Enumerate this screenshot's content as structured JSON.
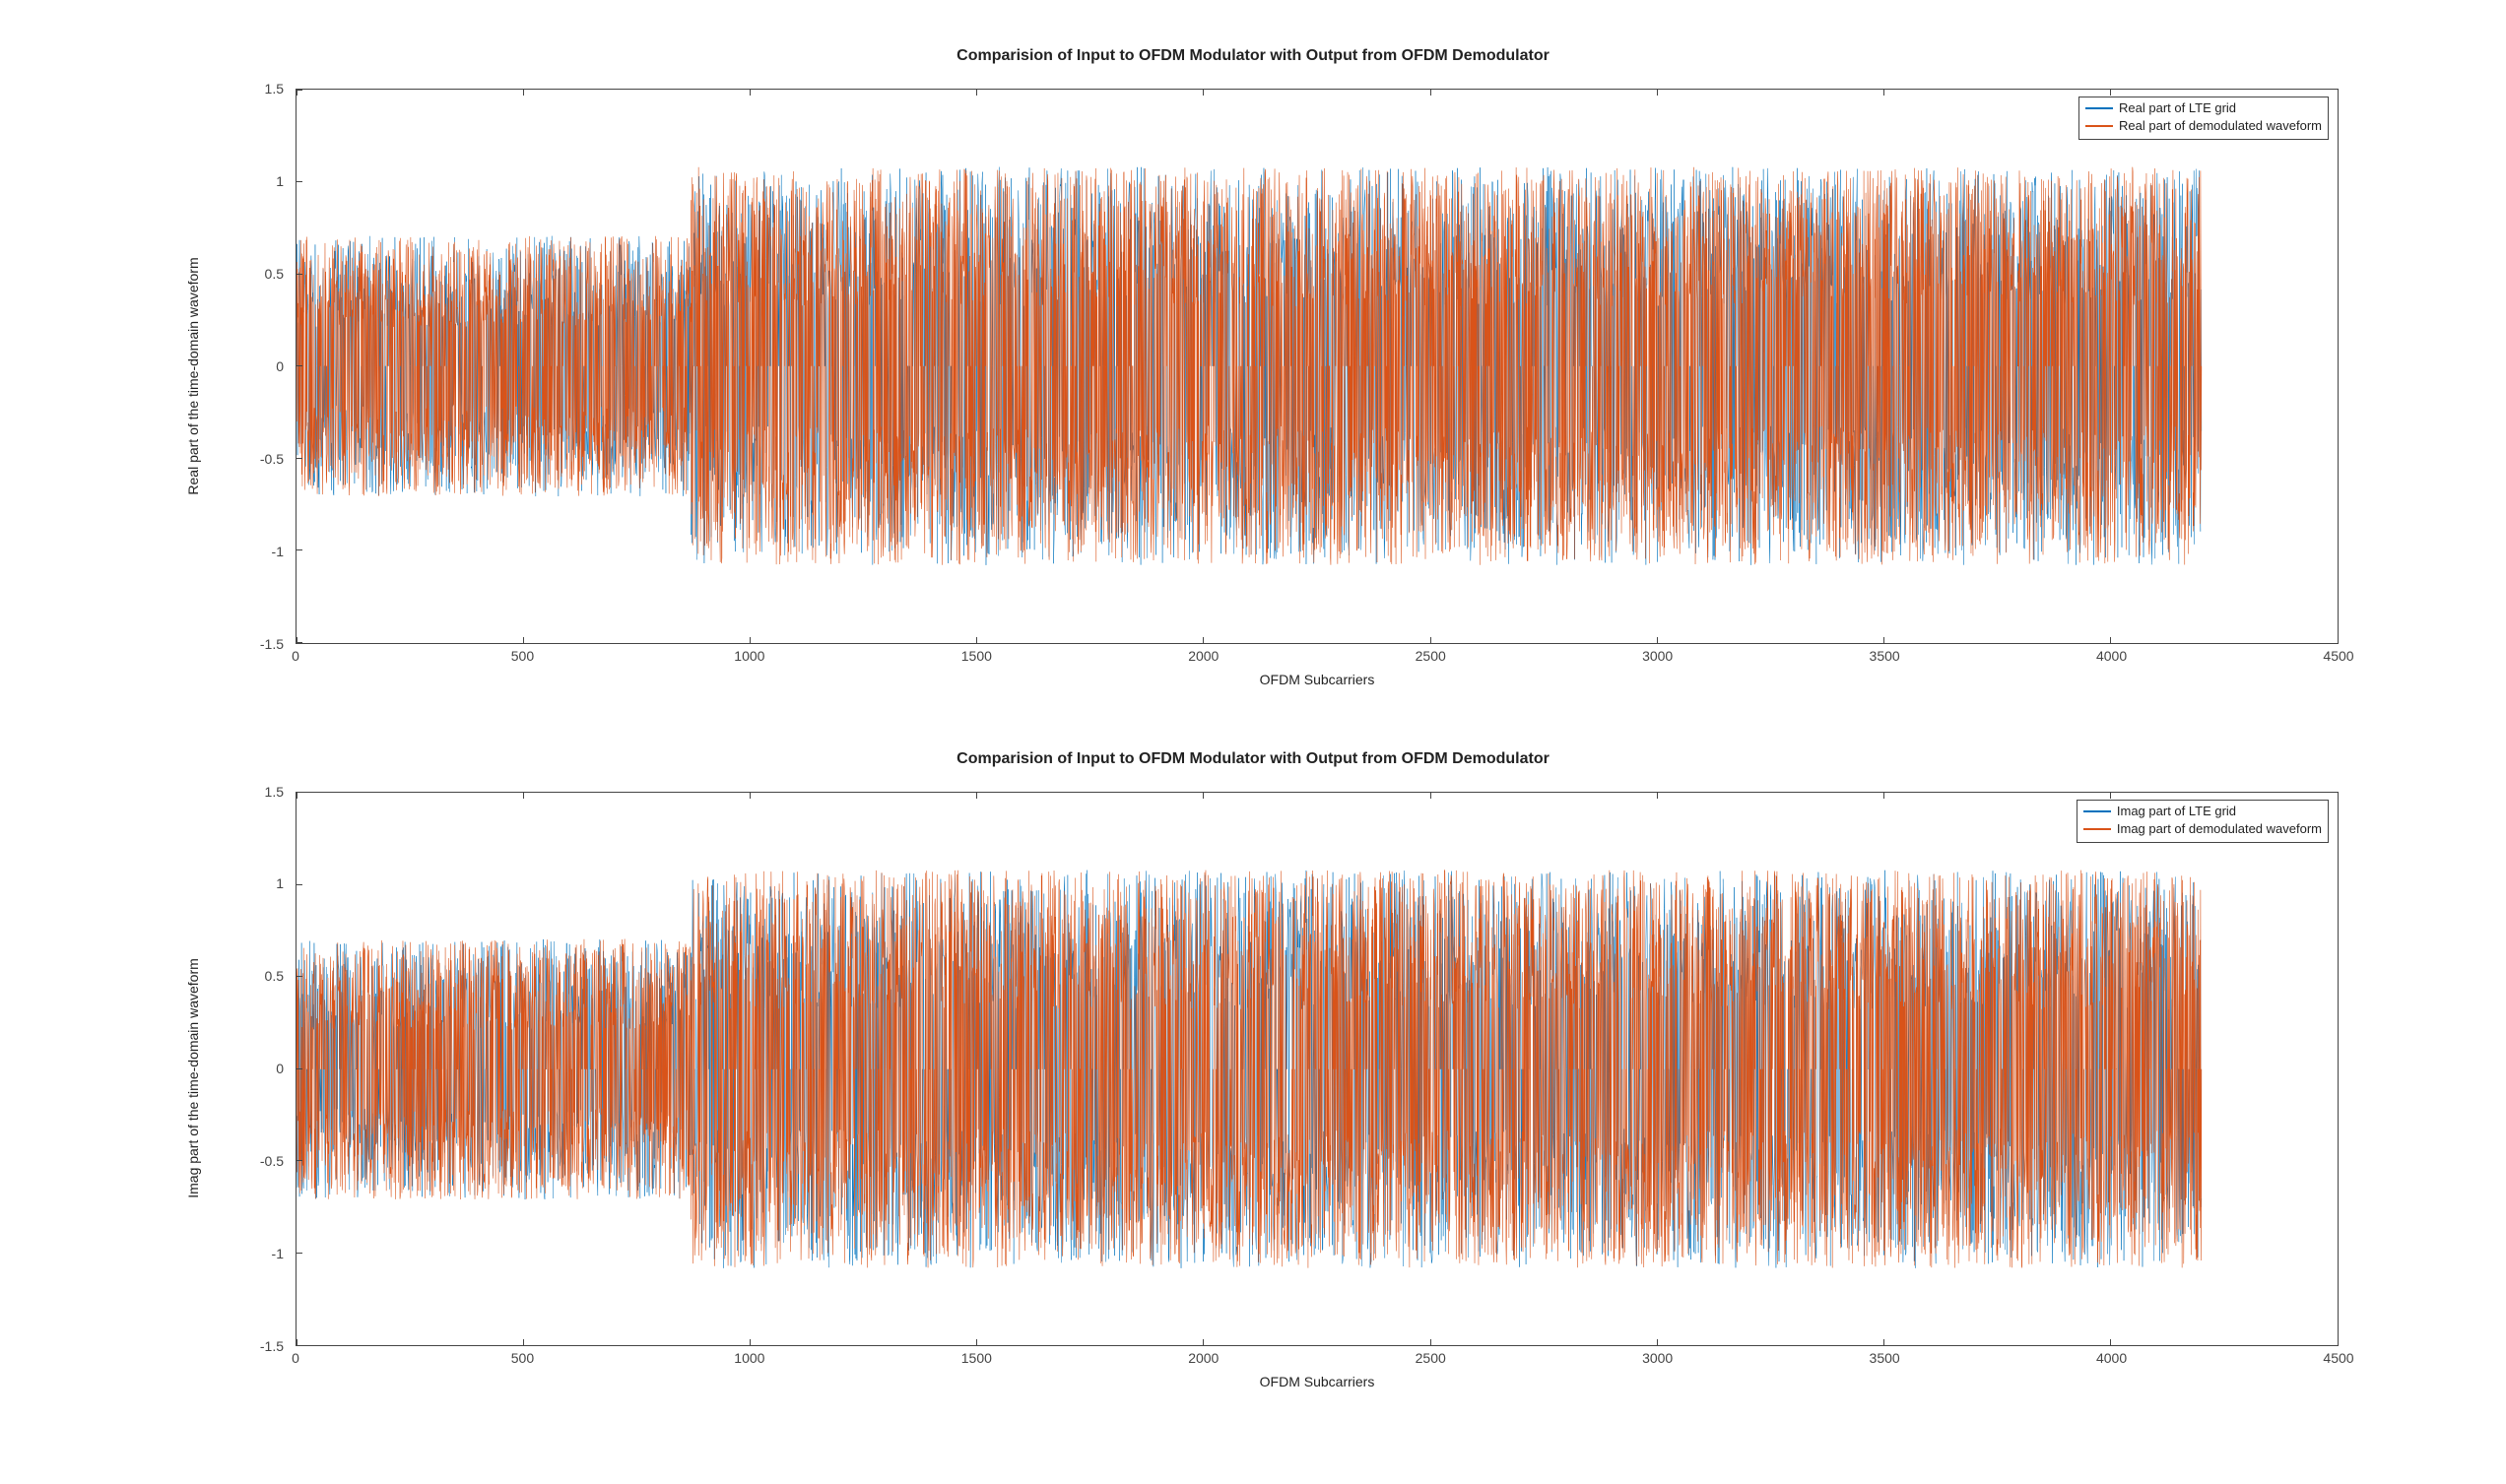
{
  "colors": {
    "series_blue": "#0072BD",
    "series_orange": "#D95319"
  },
  "chart_data": [
    {
      "type": "line",
      "title": "Comparision of Input to OFDM Modulator with Output from OFDM Demodulator",
      "xlabel": "OFDM Subcarriers",
      "ylabel": "Real part of the time-domain waveform",
      "xlim": [
        0,
        4500
      ],
      "ylim": [
        -1.5,
        1.5
      ],
      "x_ticks": [
        0,
        500,
        1000,
        1500,
        2000,
        2500,
        3000,
        3500,
        4000,
        4500
      ],
      "y_ticks": [
        -1.5,
        -1,
        -0.5,
        0,
        0.5,
        1,
        1.5
      ],
      "data_x_extent": [
        0,
        4200
      ],
      "segments": [
        {
          "x_start": 0,
          "x_end": 870,
          "amp": 0.707
        },
        {
          "x_start": 870,
          "x_end": 4200,
          "amp": 1.08
        }
      ],
      "series": [
        {
          "name": "Real part of LTE grid",
          "color": "#0072BD"
        },
        {
          "name": "Real part of demodulated waveform",
          "color": "#D95319"
        }
      ],
      "legend_position": "top-right",
      "note": "Dense random-like samples; blue series visually coincides with / is covered by orange series."
    },
    {
      "type": "line",
      "title": "Comparision of Input to OFDM Modulator with Output from OFDM Demodulator",
      "xlabel": "OFDM Subcarriers",
      "ylabel": "Imag part of the time-domain waveform",
      "xlim": [
        0,
        4500
      ],
      "ylim": [
        -1.5,
        1.5
      ],
      "x_ticks": [
        0,
        500,
        1000,
        1500,
        2000,
        2500,
        3000,
        3500,
        4000,
        4500
      ],
      "y_ticks": [
        -1.5,
        -1,
        -0.5,
        0,
        0.5,
        1,
        1.5
      ],
      "data_x_extent": [
        0,
        4200
      ],
      "segments": [
        {
          "x_start": 0,
          "x_end": 870,
          "amp": 0.707
        },
        {
          "x_start": 870,
          "x_end": 4200,
          "amp": 1.08
        }
      ],
      "series": [
        {
          "name": "Imag part of LTE grid",
          "color": "#0072BD"
        },
        {
          "name": "Imag part of demodulated waveform",
          "color": "#D95319"
        }
      ],
      "legend_position": "top-right",
      "note": "Dense random-like samples; blue series visually coincides with / is covered by orange series."
    }
  ]
}
